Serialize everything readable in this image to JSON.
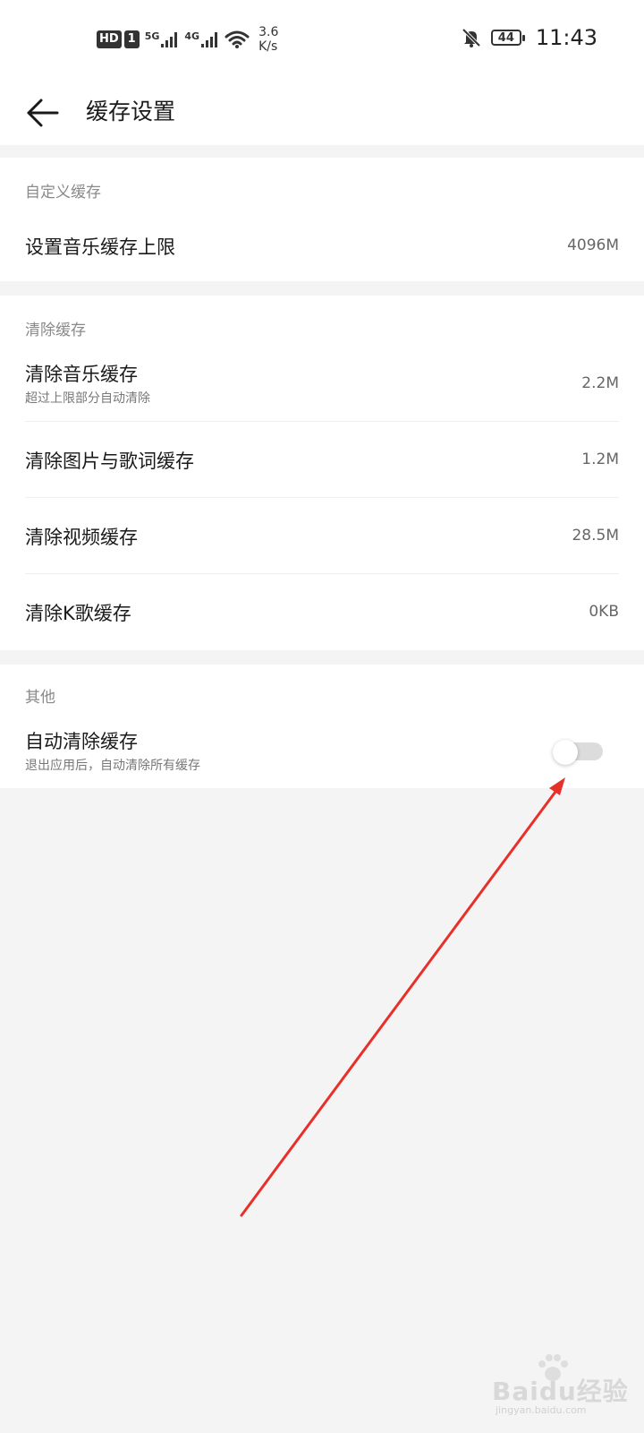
{
  "status_bar": {
    "hd": "HD",
    "sim": "1",
    "net1": "5G",
    "net2": "4G",
    "speed_value": "3.6",
    "speed_unit": "K/s",
    "battery": "44",
    "time": "11:43"
  },
  "header": {
    "title": "缓存设置"
  },
  "sections": {
    "custom": {
      "title": "自定义缓存",
      "rows": [
        {
          "label": "设置音乐缓存上限",
          "value": "4096M"
        }
      ]
    },
    "clear": {
      "title": "清除缓存",
      "rows": [
        {
          "label": "清除音乐缓存",
          "sub": "超过上限部分自动清除",
          "value": "2.2M"
        },
        {
          "label": "清除图片与歌词缓存",
          "value": "1.2M"
        },
        {
          "label": "清除视频缓存",
          "value": "28.5M"
        },
        {
          "label": "清除K歌缓存",
          "value": "0KB"
        }
      ]
    },
    "other": {
      "title": "其他",
      "rows": [
        {
          "label": "自动清除缓存",
          "sub": "退出应用后，自动清除所有缓存",
          "toggle_on": false
        }
      ]
    }
  },
  "watermark": {
    "text": "Baidu经验",
    "sub": "jingyan.baidu.com"
  },
  "colors": {
    "background": "#f4f4f4",
    "card": "#ffffff",
    "arrow": "#e8302a",
    "toggle_off": "#dcdcdc"
  }
}
